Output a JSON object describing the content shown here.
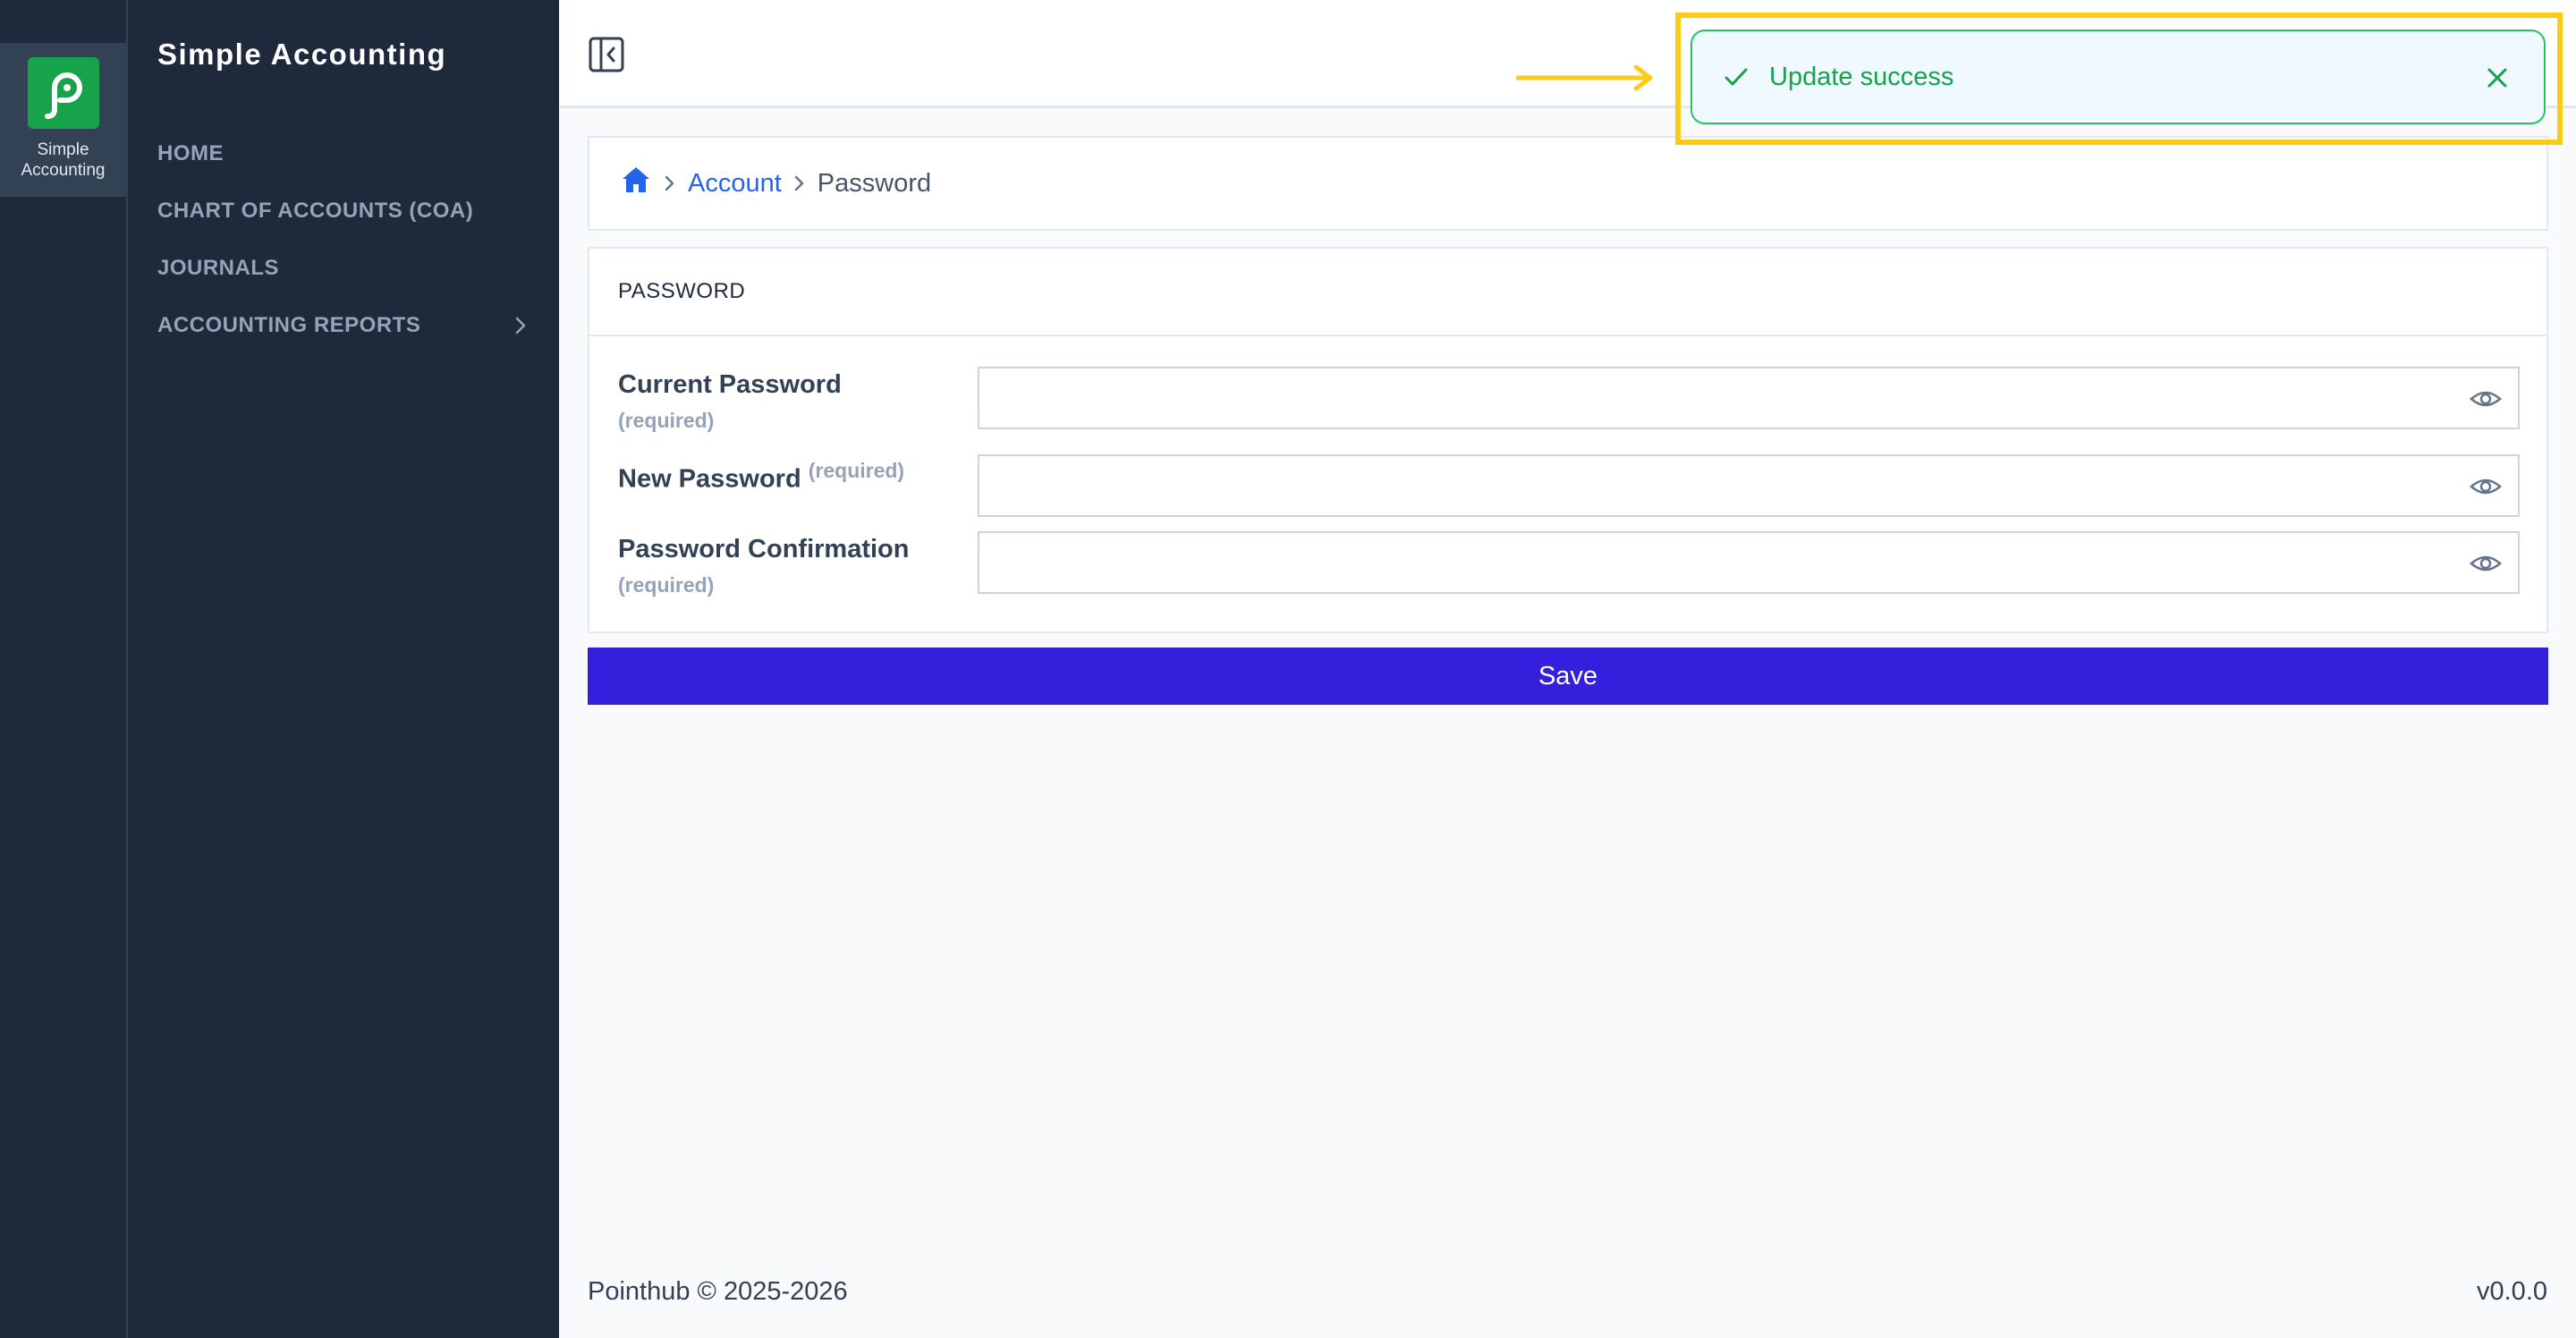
{
  "rail": {
    "app_label": "Simple Accounting",
    "logo_icon": "pointhub-p-icon",
    "logo_color": "#16a34a"
  },
  "sidebar": {
    "brand": "Simple Accounting",
    "items": [
      {
        "label": "HOME"
      },
      {
        "label": "CHART OF ACCOUNTS (COA)"
      },
      {
        "label": "JOURNALS"
      },
      {
        "label": "ACCOUNTING REPORTS",
        "icon": "chevron-right-icon"
      }
    ]
  },
  "breadcrumb": {
    "home_icon": "home-icon",
    "account": "Account",
    "current": "Password"
  },
  "form": {
    "title": "PASSWORD",
    "fields": [
      {
        "label": "Current Password",
        "required": "(required)",
        "value": ""
      },
      {
        "label": "New Password",
        "required": "(required)",
        "value": ""
      },
      {
        "label": "Password Confirmation",
        "required": "(required)",
        "value": ""
      }
    ],
    "save_label": "Save"
  },
  "toast": {
    "message": "Update success",
    "status_color": "#16a34a"
  },
  "footer": {
    "copyright": "Pointhub © 2025-2026",
    "version": "v0.0.0"
  },
  "colors": {
    "accent": "#3420dc",
    "sidebar_bg": "#1e293b",
    "link": "#2563eb",
    "highlight": "#facc15"
  }
}
